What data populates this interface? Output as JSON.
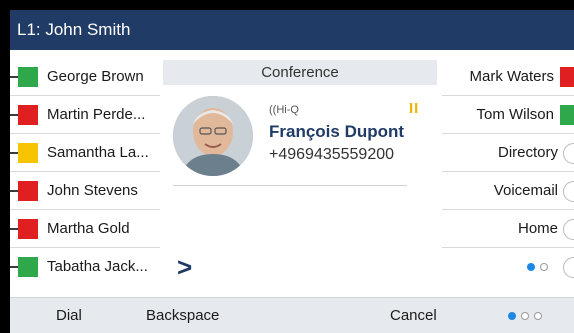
{
  "title": "L1: John Smith",
  "left_keys": [
    {
      "label": "George Brown",
      "color": "#2ea84a"
    },
    {
      "label": "Martin Perde...",
      "color": "#e02020"
    },
    {
      "label": "Samantha La...",
      "color": "#f6c400"
    },
    {
      "label": "John Stevens",
      "color": "#e02020"
    },
    {
      "label": "Martha Gold",
      "color": "#e02020"
    },
    {
      "label": "Tabatha Jack...",
      "color": "#2ea84a"
    }
  ],
  "call": {
    "header": "Conference",
    "hiq_label": "Hi-Q",
    "hiq_icon": "hiq-icon",
    "pause_icon": "II",
    "name": "François Dupont",
    "number": "+4969435559200",
    "more_glyph": ">"
  },
  "right_keys": [
    {
      "label": "Mark Waters",
      "type": "presence",
      "color": "#e02020"
    },
    {
      "label": "Tom Wilson",
      "type": "presence",
      "color": "#2ea84a"
    },
    {
      "label": "Directory",
      "type": "key"
    },
    {
      "label": "Voicemail",
      "type": "key"
    },
    {
      "label": "Home",
      "type": "key"
    },
    {
      "label": "",
      "type": "page-indicator"
    }
  ],
  "right_page": {
    "current": 1,
    "total": 2
  },
  "softkeys": {
    "dial": "Dial",
    "backspace": "Backspace",
    "cancel": "Cancel",
    "page": {
      "current": 1,
      "total": 3
    }
  }
}
